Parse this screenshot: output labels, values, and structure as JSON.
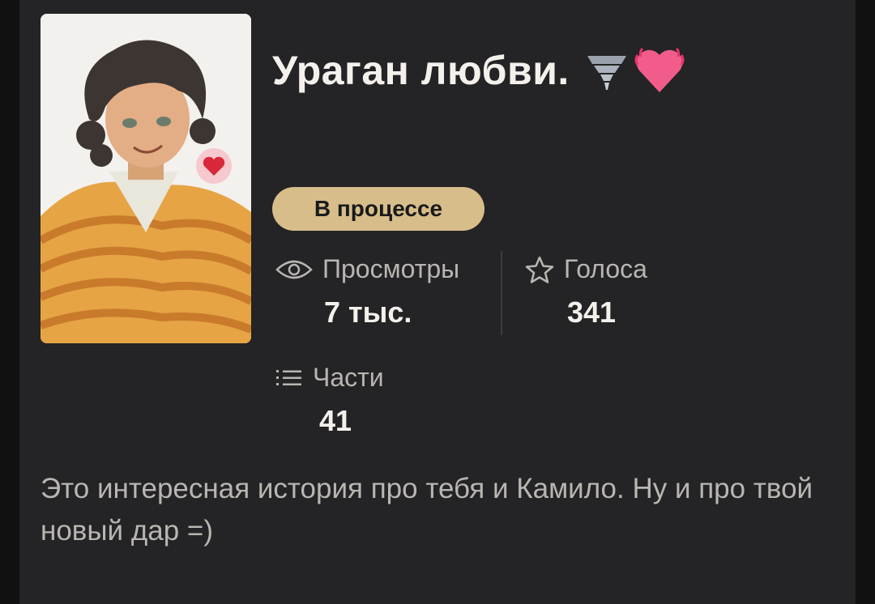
{
  "story": {
    "title": "Ураган любви.",
    "title_emojis": [
      "tornado-emoji",
      "beating-heart-emoji"
    ],
    "cover_image": "story-cover-illustration",
    "status": "В процессе",
    "description": "Это интересная история про тебя и Камило. Ну и про твой новый дар =)"
  },
  "stats": {
    "views": {
      "label": "Просмотры",
      "value": "7 тыс.",
      "icon": "eye-icon"
    },
    "votes": {
      "label": "Голоса",
      "value": "341",
      "icon": "star-icon"
    },
    "parts": {
      "label": "Части",
      "value": "41",
      "icon": "list-icon"
    }
  },
  "colors": {
    "background": "#242325",
    "status_badge": "#d7bd8a",
    "title_text": "#f4f1ec",
    "secondary_text": "#b9b6b2"
  }
}
